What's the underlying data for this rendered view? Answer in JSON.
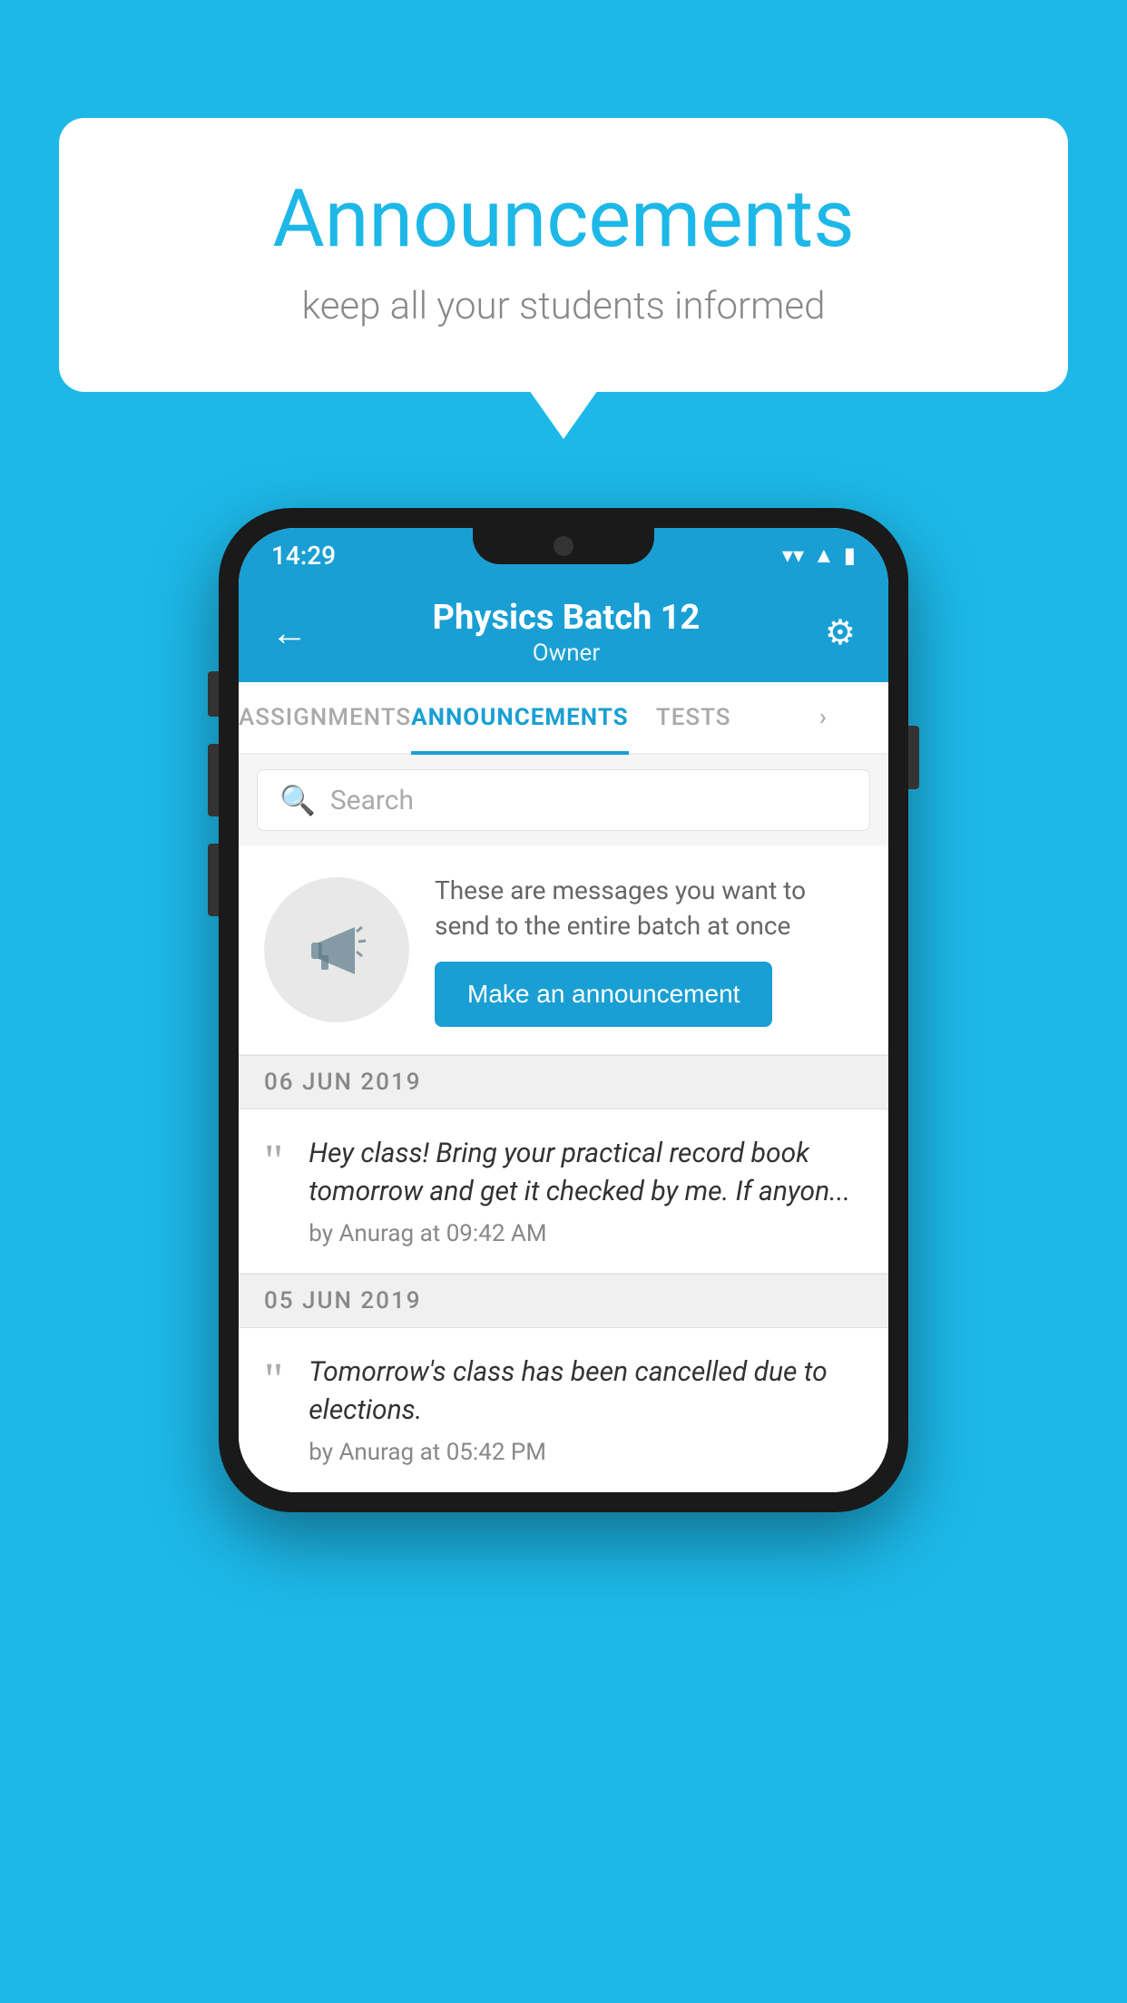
{
  "background_color": "#1db8e8",
  "speech_bubble": {
    "title": "Announcements",
    "subtitle": "keep all your students informed"
  },
  "phone": {
    "status_bar": {
      "time": "14:29",
      "wifi": "▼",
      "signal": "▲",
      "battery": "▮"
    },
    "app_bar": {
      "back_label": "←",
      "title": "Physics Batch 12",
      "subtitle": "Owner",
      "settings_label": "⚙"
    },
    "tabs": [
      {
        "label": "ASSIGNMENTS",
        "active": false
      },
      {
        "label": "ANNOUNCEMENTS",
        "active": true
      },
      {
        "label": "TESTS",
        "active": false
      },
      {
        "label": "",
        "active": false
      }
    ],
    "search": {
      "placeholder": "Search"
    },
    "announcement_banner": {
      "description": "These are messages you want to send to the entire batch at once",
      "button_label": "Make an announcement"
    },
    "dates": [
      {
        "label": "06  JUN  2019",
        "messages": [
          {
            "text": "Hey class! Bring your practical record book tomorrow and get it checked by me. If anyon...",
            "author": "by Anurag at 09:42 AM"
          }
        ]
      },
      {
        "label": "05  JUN  2019",
        "messages": [
          {
            "text": "Tomorrow's class has been cancelled due to elections.",
            "author": "by Anurag at 05:42 PM"
          }
        ]
      }
    ]
  }
}
